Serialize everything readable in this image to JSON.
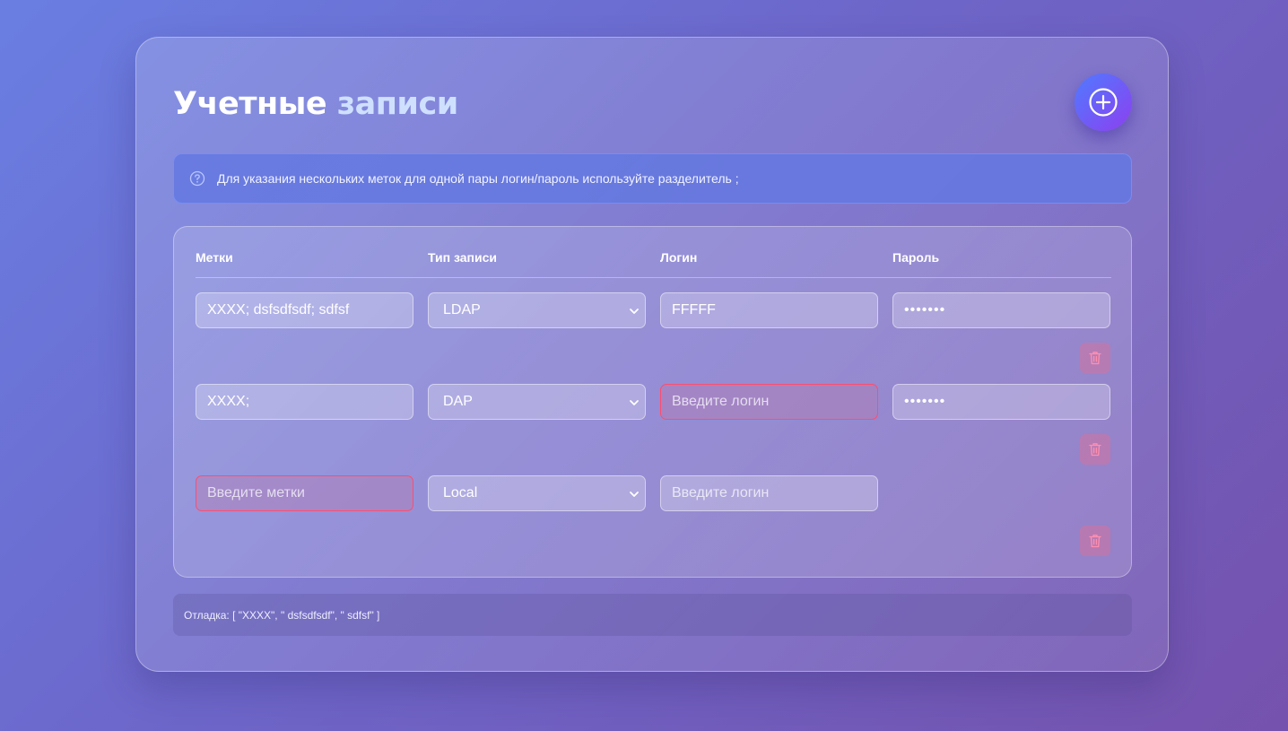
{
  "title": {
    "word1": "Учетные",
    "word2": "записи"
  },
  "info": {
    "text": "Для указания нескольких меток для одной пары логин/пароль используйте разделитель ;"
  },
  "headers": {
    "tags": "Метки",
    "type": "Тип записи",
    "login": "Логин",
    "password": "Пароль"
  },
  "rows": [
    {
      "tags": "XXXX; dsfsdfsdf; sdfsf",
      "type": "LDAP",
      "login": "FFFFF",
      "password": "•••••••"
    },
    {
      "tags": "XXXX;",
      "type": "DAP",
      "login_placeholder": "Введите логин",
      "password": "•••••••"
    },
    {
      "tags_placeholder": "Введите метки",
      "type": "Local",
      "login_placeholder": "Введите логин"
    }
  ],
  "debug": {
    "text": "Отладка: [ \"XXXX\", \" dsfsdfsdf\", \" sdfsf\" ]"
  },
  "icons": {
    "add": "plus-circle-icon",
    "info": "question-circle-icon",
    "delete": "trash-icon",
    "select": "chevron-down-icon"
  },
  "colors": {
    "error_border": "#ff4d6d",
    "accent_start": "#4f7bff",
    "accent_end": "#8d3ff0"
  }
}
